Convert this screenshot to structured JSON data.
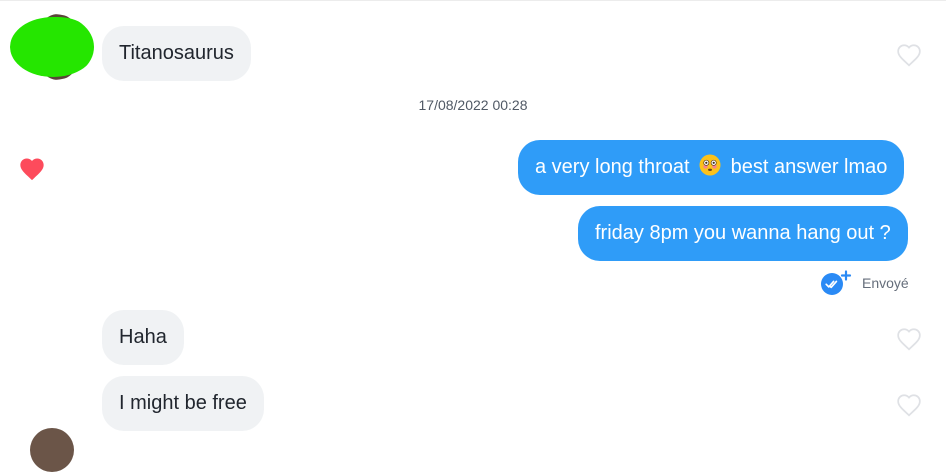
{
  "conversation": {
    "timestamp": "17/08/2022 00:28",
    "messages": [
      {
        "text": "Titanosaurus"
      },
      {
        "text_before_emoji": "a very long throat",
        "emoji": "flushed-face-emoji",
        "text_after_emoji": "best answer lmao"
      },
      {
        "text": "friday 8pm you wanna hang out ?"
      },
      {
        "text": "Haha"
      },
      {
        "text": "I might be free"
      }
    ],
    "status": {
      "label": "Envoyé",
      "icon": "double-check-icon"
    }
  },
  "colors": {
    "sent_bubble": "#2f9cf8",
    "received_bubble": "#f0f2f4",
    "like_heart": "#fd4b5c",
    "status_icon": "#2a8af5"
  }
}
